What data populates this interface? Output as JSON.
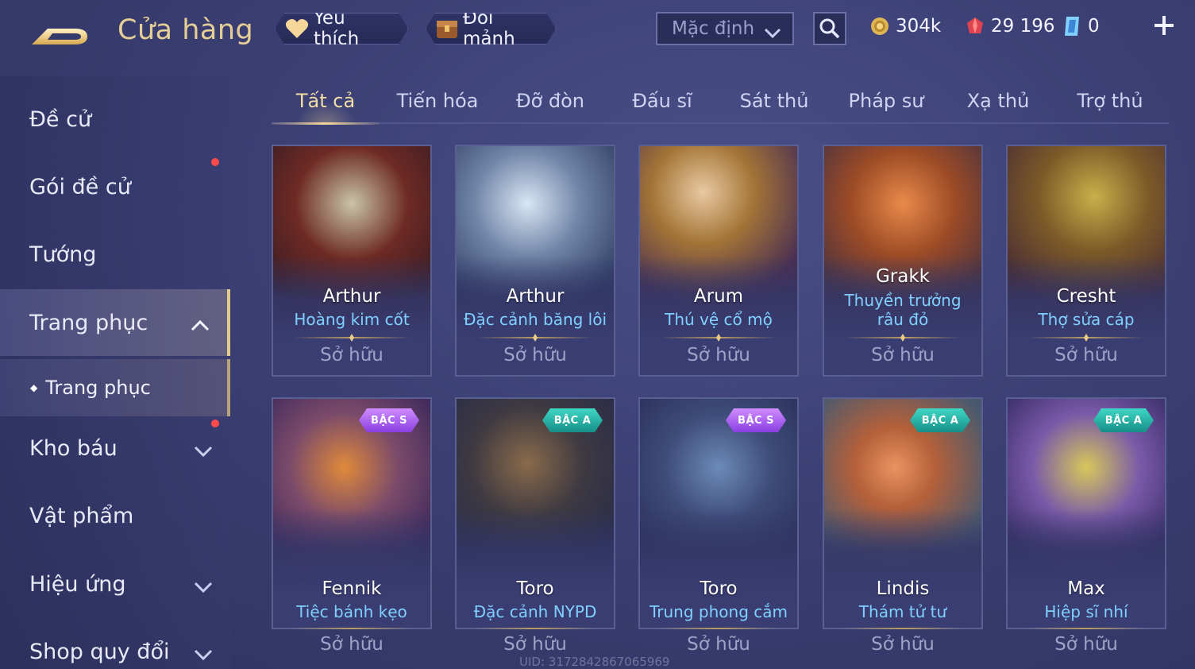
{
  "header": {
    "title": "Cửa hàng",
    "favorites_label": "Yêu thích",
    "fragments_label": "Đổi mảnh",
    "sort_value": "Mặc định"
  },
  "currencies": {
    "gold": "304k",
    "voucher": "29 196",
    "diamond": "0"
  },
  "sidebar": {
    "items": [
      {
        "label": "Đề cử"
      },
      {
        "label": "Gói đề cử"
      },
      {
        "label": "Tướng"
      },
      {
        "label": "Trang phục"
      },
      {
        "label": "Kho báu"
      },
      {
        "label": "Vật phẩm"
      },
      {
        "label": "Hiệu ứng"
      },
      {
        "label": "Shop quy đổi"
      }
    ],
    "sub_item": "Trang phục"
  },
  "tabs": [
    "Tất cả",
    "Tiến hóa",
    "Đỡ đòn",
    "Đấu sĩ",
    "Sát thủ",
    "Pháp sư",
    "Xạ thủ",
    "Trợ thủ"
  ],
  "cards": [
    {
      "hero": "Arthur",
      "skin": "Hoàng kim cốt",
      "status": "Sở hữu"
    },
    {
      "hero": "Arthur",
      "skin": "Đặc cảnh băng lôi",
      "status": "Sở hữu"
    },
    {
      "hero": "Arum",
      "skin": "Thú vệ cổ mộ",
      "status": "Sở hữu"
    },
    {
      "hero": "Grakk",
      "skin": "Thuyền trưởng râu đỏ",
      "status": "Sở hữu"
    },
    {
      "hero": "Cresht",
      "skin": "Thợ sửa cáp",
      "status": "Sở hữu"
    },
    {
      "hero": "Fennik",
      "skin": "Tiệc bánh kẹo",
      "status": "Sở hữu",
      "badge": "BẬC S"
    },
    {
      "hero": "Toro",
      "skin": "Đặc cảnh NYPD",
      "status": "Sở hữu",
      "badge": "BẬC A"
    },
    {
      "hero": "Toro",
      "skin": "Trung phong cắm",
      "status": "Sở hữu",
      "badge": "BẬC S"
    },
    {
      "hero": "Lindis",
      "skin": "Thám tử tư",
      "status": "Sở hữu",
      "badge": "BẬC A"
    },
    {
      "hero": "Max",
      "skin": "Hiệp sĩ nhí",
      "status": "Sở hữu",
      "badge": "BẬC A"
    }
  ],
  "footer": {
    "uid": "UID: 3172842867065969"
  },
  "colors": {
    "accent_gold": "#e6cf96",
    "skin_blue": "#7fd0ff",
    "badge_s": "#a455f0",
    "badge_a": "#22a99f"
  }
}
